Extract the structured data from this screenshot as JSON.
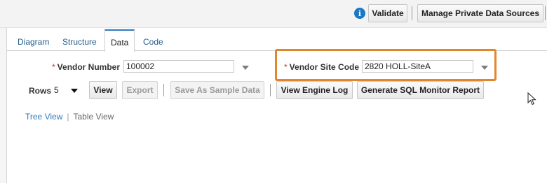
{
  "toolbar": {
    "validate_label": "Validate",
    "manage_label": "Manage Private Data Sources"
  },
  "tabs": [
    {
      "label": "Diagram"
    },
    {
      "label": "Structure"
    },
    {
      "label": "Data"
    },
    {
      "label": "Code"
    }
  ],
  "params": {
    "required_marker": "*",
    "vendor_number": {
      "label": "Vendor Number",
      "value": "100002"
    },
    "vendor_site_code": {
      "label": "Vendor Site Code",
      "value": "2820 HOLL-SiteA"
    }
  },
  "actions": {
    "rows_label": "Rows",
    "rows_value": "5",
    "view": "View",
    "export": "Export",
    "save_sample": "Save As Sample Data",
    "view_engine_log": "View Engine Log",
    "sql_monitor": "Generate SQL Monitor Report"
  },
  "views": {
    "tree": "Tree View",
    "separator": "|",
    "table": "Table View"
  },
  "colors": {
    "accent": "#2e7ac0",
    "highlight": "#e1862f",
    "info_icon": "#1b78c7"
  }
}
